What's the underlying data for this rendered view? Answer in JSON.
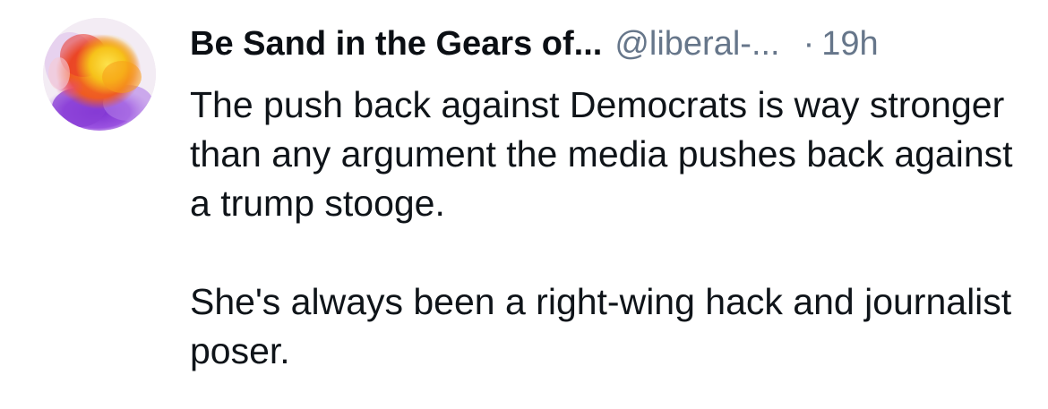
{
  "post": {
    "author": {
      "display_name": "Be Sand in the Gears of...",
      "handle": "@liberal-...",
      "avatar_icon": "abstract-watercolor-avatar-icon"
    },
    "separator": "·",
    "timestamp": "19h",
    "paragraphs": [
      "The push back against Democrats is way stronger than any argument the media pushes back against a trump stooge.",
      "She's always been a right-wing hack and journalist poser."
    ]
  },
  "colors": {
    "text_primary": "#0f1419",
    "text_secondary": "#66768a",
    "background": "#ffffff",
    "avatar_yellow": "#f6c21a",
    "avatar_orange": "#ef5a22",
    "avatar_purple": "#8a3fd6"
  }
}
